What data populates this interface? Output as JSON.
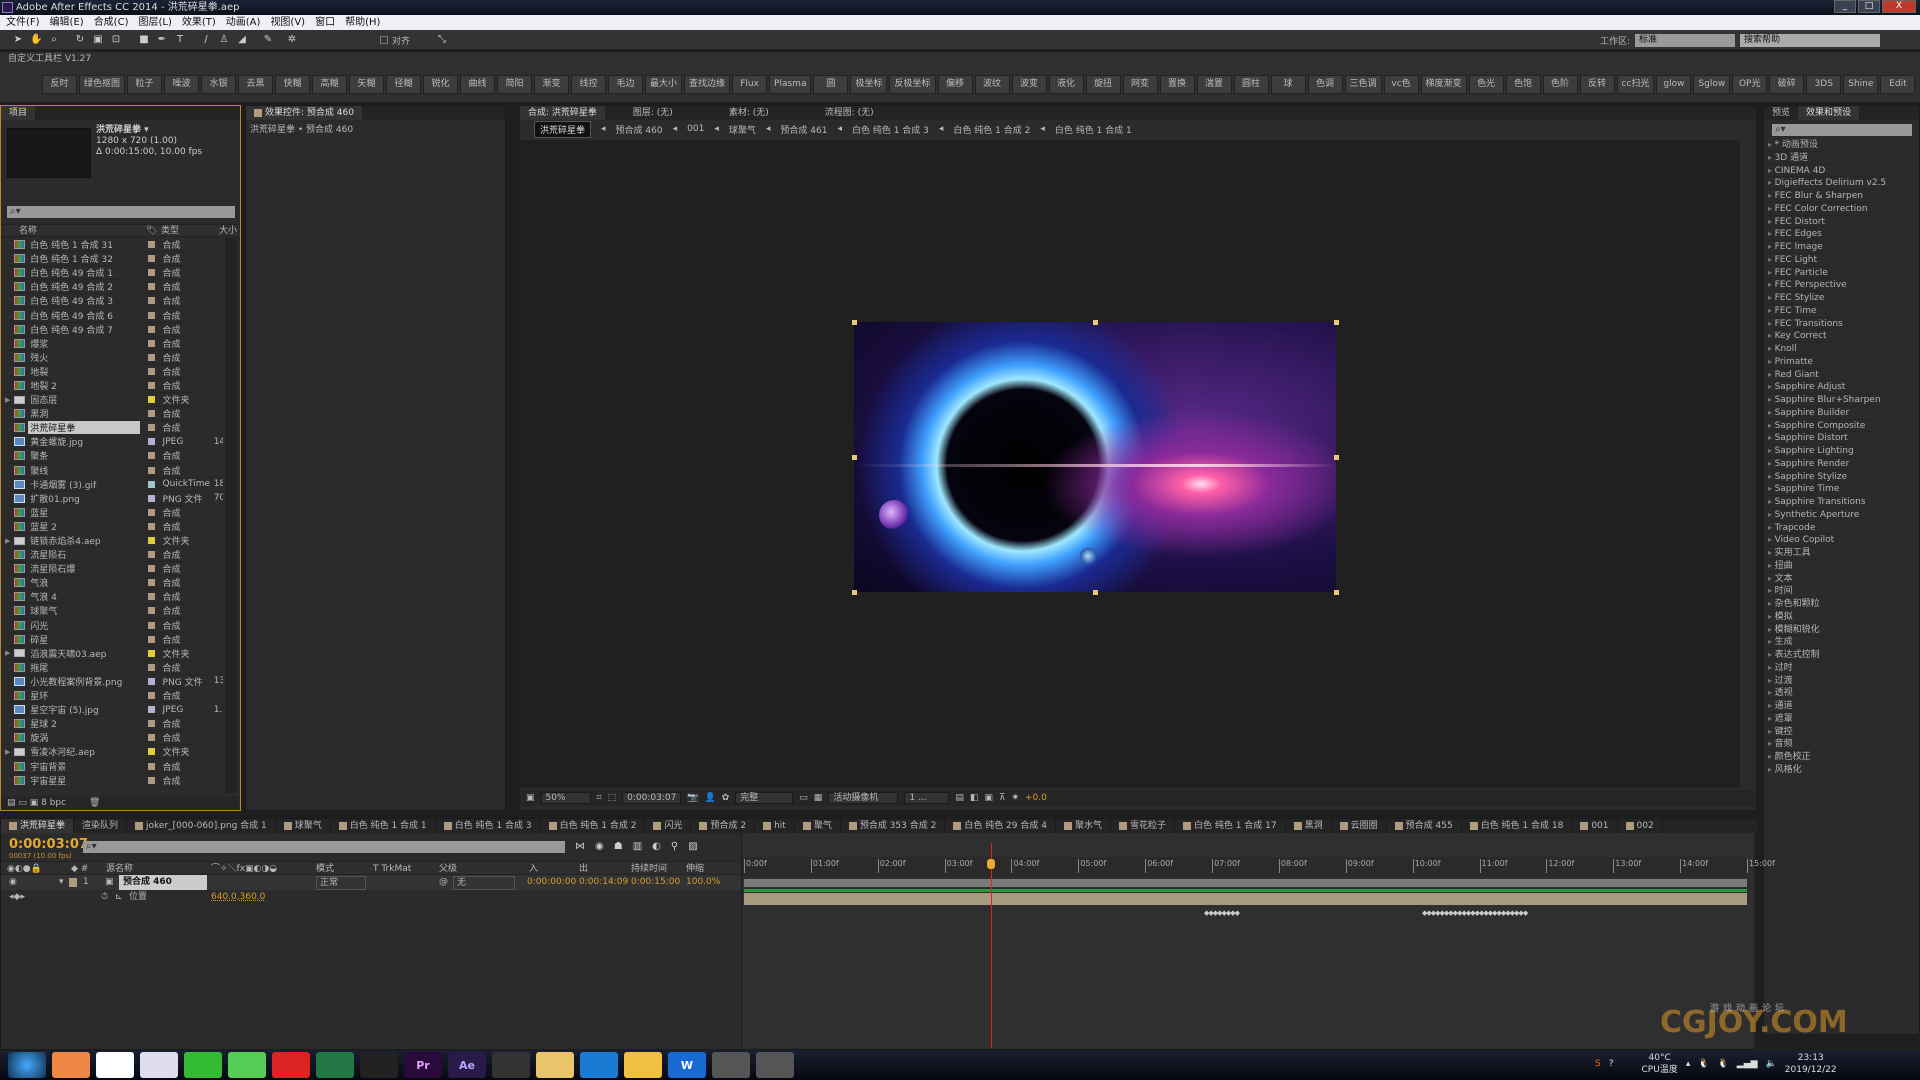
{
  "window": {
    "title": "Adobe After Effects CC 2014 - 洪荒碎星拳.aep",
    "controls": [
      "_",
      "□",
      "X"
    ]
  },
  "menu": [
    "文件(F)",
    "编辑(E)",
    "合成(C)",
    "图层(L)",
    "效果(T)",
    "动画(A)",
    "视图(V)",
    "窗口",
    "帮助(H)"
  ],
  "toolbar": {
    "snap_label": "对齐",
    "workspace_label": "工作区:",
    "workspace_value": "标准",
    "help_search": "搜索帮助"
  },
  "custom_toolbar": {
    "title": "自定义工具栏 V1.27",
    "buttons": [
      "反时",
      "绿色抠图",
      "粒子",
      "噪波",
      "水银",
      "去黑",
      "快糊",
      "高糊",
      "矢糊",
      "径糊",
      "锐化",
      "曲线",
      "简阳",
      "渐变",
      "线控",
      "毛边",
      "最大小",
      "查找边缘",
      "Flux",
      "Plasma",
      "圆",
      "极坐标",
      "反极坐标",
      "偏移",
      "波纹",
      "波变",
      "液化",
      "旋扭",
      "网变",
      "置换",
      "湍置",
      "圆柱",
      "球",
      "色调",
      "三色调",
      "vc色",
      "梯度渐变",
      "色光",
      "色饱",
      "色阶",
      "反转",
      "cc扫光",
      "glow",
      "Sglow",
      "OP光",
      "破碎",
      "3DS",
      "Shine",
      "Edit"
    ]
  },
  "project": {
    "tab": "项目",
    "comp_name": "洪荒碎星拳 ▾",
    "comp_size": "1280 x 720 (1.00)",
    "comp_duration": "Δ 0:00:15:00, 10.00 fps",
    "columns": {
      "name": "名称",
      "type": "类型",
      "size": "大小"
    },
    "bpc": "8 bpc",
    "items": [
      {
        "name": "白色 纯色 1 合成 31",
        "type": "合成",
        "kind": "comp"
      },
      {
        "name": "白色 纯色 1 合成 32",
        "type": "合成",
        "kind": "comp"
      },
      {
        "name": "白色 纯色 49 合成 1",
        "type": "合成",
        "kind": "comp"
      },
      {
        "name": "白色 纯色 49 合成 2",
        "type": "合成",
        "kind": "comp"
      },
      {
        "name": "白色 纯色 49 合成 3",
        "type": "合成",
        "kind": "comp"
      },
      {
        "name": "白色 纯色 49 合成 6",
        "type": "合成",
        "kind": "comp"
      },
      {
        "name": "白色 纯色 49 合成 7",
        "type": "合成",
        "kind": "comp"
      },
      {
        "name": "爆浆",
        "type": "合成",
        "kind": "comp"
      },
      {
        "name": "残火",
        "type": "合成",
        "kind": "comp"
      },
      {
        "name": "地裂",
        "type": "合成",
        "kind": "comp"
      },
      {
        "name": "地裂 2",
        "type": "合成",
        "kind": "comp"
      },
      {
        "name": "固态层",
        "type": "文件夹",
        "kind": "folder"
      },
      {
        "name": "黑洞",
        "type": "合成",
        "kind": "comp"
      },
      {
        "name": "洪荒碎星拳",
        "type": "合成",
        "kind": "comp",
        "selected": true
      },
      {
        "name": "黄金螺旋.jpg",
        "type": "JPEG",
        "kind": "img",
        "size": "14"
      },
      {
        "name": "聚条",
        "type": "合成",
        "kind": "comp"
      },
      {
        "name": "聚线",
        "type": "合成",
        "kind": "comp"
      },
      {
        "name": "卡通烟雾 (3).gif",
        "type": "QuickTime",
        "kind": "img",
        "size": "18"
      },
      {
        "name": "扩散01.png",
        "type": "PNG 文件",
        "kind": "img",
        "size": "70"
      },
      {
        "name": "蓝星",
        "type": "合成",
        "kind": "comp"
      },
      {
        "name": "蓝星 2",
        "type": "合成",
        "kind": "comp"
      },
      {
        "name": "链锁赤焰杀4.aep",
        "type": "文件夹",
        "kind": "folder"
      },
      {
        "name": "流星陨石",
        "type": "合成",
        "kind": "comp"
      },
      {
        "name": "流星陨石爆",
        "type": "合成",
        "kind": "comp"
      },
      {
        "name": "气浪",
        "type": "合成",
        "kind": "comp"
      },
      {
        "name": "气浪 4",
        "type": "合成",
        "kind": "comp"
      },
      {
        "name": "球聚气",
        "type": "合成",
        "kind": "comp"
      },
      {
        "name": "闪光",
        "type": "合成",
        "kind": "comp"
      },
      {
        "name": "碎星",
        "type": "合成",
        "kind": "comp"
      },
      {
        "name": "滔浪震天啸03.aep",
        "type": "文件夹",
        "kind": "folder"
      },
      {
        "name": "拖尾",
        "type": "合成",
        "kind": "comp"
      },
      {
        "name": "小光教程案例背景.png",
        "type": "PNG 文件",
        "kind": "img",
        "size": "13"
      },
      {
        "name": "星环",
        "type": "合成",
        "kind": "comp"
      },
      {
        "name": "星空宇宙 (5).jpg",
        "type": "JPEG",
        "kind": "img",
        "size": "1."
      },
      {
        "name": "星球 2",
        "type": "合成",
        "kind": "comp"
      },
      {
        "name": "旋涡",
        "type": "合成",
        "kind": "comp"
      },
      {
        "name": "雪凌冰河纪.aep",
        "type": "文件夹",
        "kind": "folder"
      },
      {
        "name": "宇宙背景",
        "type": "合成",
        "kind": "comp"
      },
      {
        "name": "宇宙星星",
        "type": "合成",
        "kind": "comp"
      }
    ]
  },
  "effect_controls": {
    "tab": "效果控件: 预合成 460",
    "path": "洪荒碎星拳 • 预合成 460"
  },
  "composition": {
    "tabs": [
      "合成: 洪荒碎星拳",
      "图层: (无)",
      "素材: (无)",
      "流程图: (无)"
    ],
    "breadcrumbs": [
      "洪荒碎星拳",
      "预合成 460",
      "001",
      "球聚气",
      "预合成 461",
      "白色 纯色 1 合成 3",
      "白色 纯色 1 合成 2",
      "白色 纯色 1 合成 1"
    ],
    "zoom": "50%",
    "timecode": "0:00:03:07",
    "resolution": "完整",
    "camera": "活动摄像机",
    "views": "1 ...",
    "exposure": "+0.0"
  },
  "effects_panel": {
    "tabs": [
      "预览",
      "效果和预设"
    ],
    "items": [
      "* 动画预设",
      "3D 通道",
      "CINEMA 4D",
      "Digieffects Delirium v2.5",
      "FEC Blur & Sharpen",
      "FEC Color Correction",
      "FEC Distort",
      "FEC Edges",
      "FEC Image",
      "FEC Light",
      "FEC Particle",
      "FEC Perspective",
      "FEC Stylize",
      "FEC Time",
      "FEC Transitions",
      "Key Correct",
      "Knoll",
      "Primatte",
      "Red Giant",
      "Sapphire Adjust",
      "Sapphire Blur+Sharpen",
      "Sapphire Builder",
      "Sapphire Composite",
      "Sapphire Distort",
      "Sapphire Lighting",
      "Sapphire Render",
      "Sapphire Stylize",
      "Sapphire Time",
      "Sapphire Transitions",
      "Synthetic Aperture",
      "Trapcode",
      "Video Copilot",
      "实用工具",
      "扭曲",
      "文本",
      "时间",
      "杂色和颗粒",
      "模拟",
      "模糊和锐化",
      "生成",
      "表达式控制",
      "过时",
      "过渡",
      "透视",
      "通道",
      "遮罩",
      "键控",
      "音频",
      "颜色校正",
      "风格化"
    ]
  },
  "timeline": {
    "tabs": [
      "洪荒碎星拳",
      "渲染队列",
      "joker_[000-060].png 合成 1",
      "球聚气",
      "白色 纯色 1 合成 1",
      "白色 纯色 1 合成 3",
      "白色 纯色 1 合成 2",
      "闪光",
      "预合成 2",
      "hit",
      "聚气",
      "预合成 353 合成 2",
      "白色 纯色 29 合成 4",
      "聚水气",
      "雪花粒子",
      "白色 纯色 1 合成 17",
      "黑洞",
      "云圈圈",
      "预合成 455",
      "白色 纯色 1 合成 18",
      "001",
      "002"
    ],
    "current_time": "0:00:03:07",
    "frame_info": "00037 (10.00 fps)",
    "columns": {
      "source": "源名称",
      "mode": "模式",
      "trkmat": "T  TrkMat",
      "parent": "父级",
      "in": "入",
      "out": "出",
      "duration": "持续时间",
      "stretch": "伸缩"
    },
    "layer": {
      "index": "1",
      "name": "预合成 460",
      "mode": "正常",
      "parent": "无",
      "in": "0:00:00:00",
      "out": "0:00:14:09",
      "duration": "0:00:15:00",
      "stretch": "100.0%"
    },
    "property": {
      "name": "位置",
      "value": "640.0,360.0"
    },
    "ruler": [
      "0:00f",
      "01:00f",
      "02:00f",
      "03:00f",
      "04:00f",
      "05:00f",
      "06:00f",
      "07:00f",
      "08:00f",
      "09:00f",
      "10:00f",
      "11:00f",
      "12:00f",
      "13:00f",
      "14:00f",
      "15:00f"
    ],
    "duration_seconds": 15,
    "current_seconds": 3.7,
    "keyframes": [
      "◆◆◆◆◆◆◆◆",
      "◆◆◆◆◆◆◆◆◆◆◆◆◆◆◆◆◆◆◆◆◆◆◆◆"
    ]
  },
  "taskbar": {
    "apps": [
      "start",
      "colors",
      "baidu-netdisk",
      "feishu",
      "wechat",
      "360",
      "netease-music",
      "globe",
      "tool",
      "Pr",
      "Ae",
      "bee",
      "explorer",
      "player",
      "notepad",
      "W",
      "app1",
      "app2"
    ],
    "cpu_temp": "40°C",
    "cpu_label": "CPU温度",
    "time": "23:13",
    "date": "2019/12/22"
  },
  "watermark": {
    "text": "CGJOY.COM",
    "sub": "游戏动画论坛"
  }
}
